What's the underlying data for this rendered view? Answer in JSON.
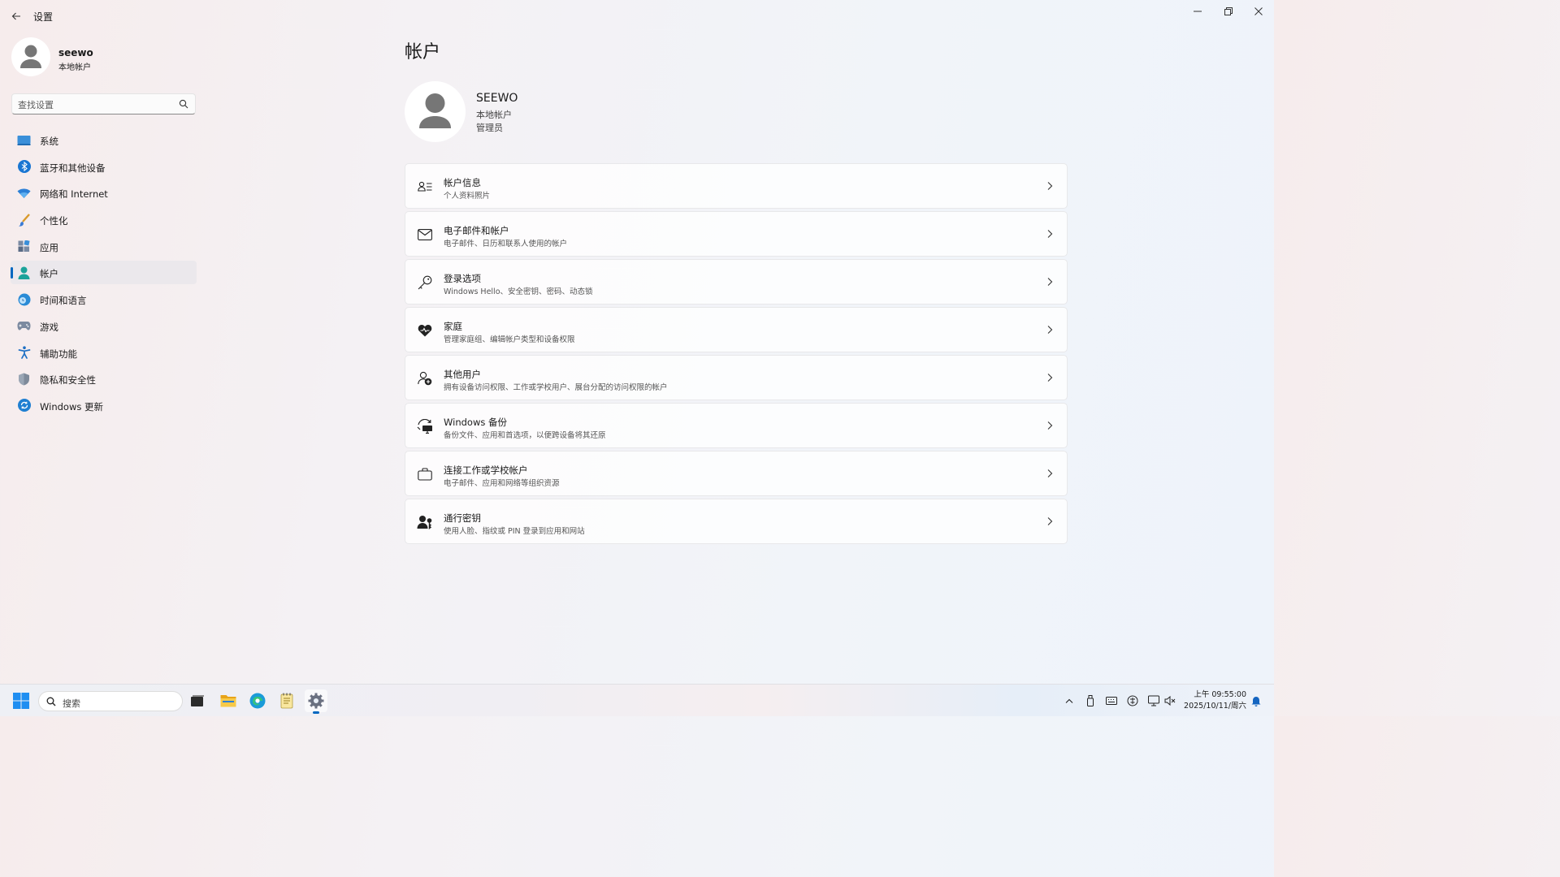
{
  "window": {
    "title": "设置"
  },
  "user": {
    "name": "seewo",
    "account_type": "本地帐户"
  },
  "search": {
    "placeholder": "查找设置"
  },
  "nav": {
    "items": [
      {
        "label": "系统",
        "icon": "system-icon",
        "active": false
      },
      {
        "label": "蓝牙和其他设备",
        "icon": "bluetooth-icon",
        "active": false
      },
      {
        "label": "网络和 Internet",
        "icon": "wifi-icon",
        "active": false
      },
      {
        "label": "个性化",
        "icon": "brush-icon",
        "active": false
      },
      {
        "label": "应用",
        "icon": "apps-icon",
        "active": false
      },
      {
        "label": "帐户",
        "icon": "account-icon",
        "active": true
      },
      {
        "label": "时间和语言",
        "icon": "time-language-icon",
        "active": false
      },
      {
        "label": "游戏",
        "icon": "gamepad-icon",
        "active": false
      },
      {
        "label": "辅助功能",
        "icon": "accessibility-icon",
        "active": false
      },
      {
        "label": "隐私和安全性",
        "icon": "shield-icon",
        "active": false
      },
      {
        "label": "Windows 更新",
        "icon": "update-icon",
        "active": false
      }
    ]
  },
  "main": {
    "title": "帐户",
    "profile": {
      "name": "SEEWO",
      "account_type": "本地帐户",
      "role": "管理员"
    },
    "cards": [
      {
        "title": "帐户信息",
        "subtitle": "个人资料照片",
        "icon": "account-info-icon"
      },
      {
        "title": "电子邮件和帐户",
        "subtitle": "电子邮件、日历和联系人使用的帐户",
        "icon": "mail-icon"
      },
      {
        "title": "登录选项",
        "subtitle": "Windows Hello、安全密钥、密码、动态锁",
        "icon": "key-icon"
      },
      {
        "title": "家庭",
        "subtitle": "管理家庭组、编辑帐户类型和设备权限",
        "icon": "family-heart-icon"
      },
      {
        "title": "其他用户",
        "subtitle": "拥有设备访问权限、工作或学校用户、展台分配的访问权限的帐户",
        "icon": "add-user-icon"
      },
      {
        "title": "Windows 备份",
        "subtitle": "备份文件、应用和首选项，以便跨设备将其还原",
        "icon": "backup-icon"
      },
      {
        "title": "连接工作或学校帐户",
        "subtitle": "电子邮件、应用和网络等组织资源",
        "icon": "briefcase-icon"
      },
      {
        "title": "通行密钥",
        "subtitle": "使用人脸、指纹或 PIN 登录到应用和网站",
        "icon": "passkey-icon"
      }
    ]
  },
  "taskbar": {
    "search_label": "搜索",
    "time": "上午 09:55:00",
    "date": "2025/10/11/周六"
  },
  "colors": {
    "accent": "#0067c0"
  }
}
